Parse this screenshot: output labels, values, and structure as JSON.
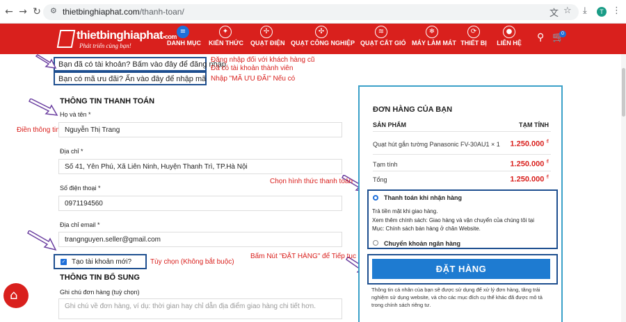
{
  "browser": {
    "url_domain": "thietbinghiaphat.com",
    "url_path": "/thanh-toan/",
    "avatar_letter": "T"
  },
  "site": {
    "logo_text": "thietbinghiaphat",
    "logo_suffix": "•com",
    "logo_slogan": "Phát triển cùng bạn!",
    "brand_color": "#d9201d",
    "menu": [
      {
        "label": "DANH MỤC",
        "icon": "menu-icon"
      },
      {
        "label": "KIẾN THỨC",
        "icon": "lightbulb-icon"
      },
      {
        "label": "QUẠT ĐIỆN",
        "icon": "fan-icon"
      },
      {
        "label": "QUẠT CÔNG NGHIỆP",
        "icon": "industrial-fan-icon"
      },
      {
        "label": "QUẠT CẮT GIÓ",
        "icon": "air-curtain-icon"
      },
      {
        "label": "MÁY LÀM MÁT",
        "icon": "cooler-icon"
      },
      {
        "label": "THIẾT BỊ",
        "icon": "device-icon"
      },
      {
        "label": "LIÊN HỆ",
        "icon": "location-icon"
      }
    ],
    "cart_count": "0"
  },
  "top": {
    "login_prompt": "Bạn đã có tài khoản? Bấm vào đây để đăng nhập",
    "login_note_1": "Đăng nhập đối với khách hàng cũ",
    "login_note_2": "Đã có tài khoản thành viên",
    "coupon_prompt": "Bạn có mã ưu đãi? Ấn vào đây để nhập mã",
    "coupon_note": "Nhập \"MÃ ƯU ĐÃI\" Nếu có"
  },
  "billing": {
    "title": "THÔNG TIN THANH TOÁN",
    "fill_note": "Điền thông tin",
    "name_label": "Họ và tên *",
    "name_value": "Nguyễn Thị Trang",
    "address_label": "Địa chỉ *",
    "address_value": "Số 41, Yên Phú, Xã Liên Ninh, Huyện Thanh Trì, TP.Hà Nội",
    "phone_label": "Số điện thoại *",
    "phone_value": "0971194560",
    "email_label": "Địa chỉ email *",
    "email_value": "trangnguyen.seller@gmail.com",
    "create_account_label": "Tạo tài khoản mới?",
    "create_account_note": "Tùy  chọn (Không bắt buộc)"
  },
  "extra": {
    "title": "THÔNG TIN BỔ SUNG",
    "notes_label": "Ghi chú đơn hàng (tuỳ chọn)",
    "notes_placeholder": "Ghi chú về đơn hàng, ví dụ: thời gian hay chỉ dẫn địa điểm giao hàng chi tiết hơn."
  },
  "order": {
    "title": "ĐƠN HÀNG CỦA BẠN",
    "col_product": "SẢN PHẨM",
    "col_subtotal": "TẠM TÍNH",
    "product_name": "Quạt hút gắn tường Panasonic FV-30AU1",
    "product_qty": "× 1",
    "product_price": "1.250.000",
    "subtotal_label": "Tạm tính",
    "subtotal_value": "1.250.000",
    "total_label": "Tổng",
    "total_value": "1.250.000",
    "currency": "₫",
    "payment_note": "Chọn hình thức thanh toán",
    "payment_cod": "Thanh toán khi nhận hàng",
    "payment_cod_desc_1": "Trả tiền mặt khi giao hàng.",
    "payment_cod_desc_2": "Xem thêm chính sách: Giao hàng và vận chuyển của chúng tôi tại",
    "payment_cod_desc_3": "Mục: Chính sách bán hàng ở chân Website.",
    "payment_bank": "Chuyển khoản ngân hàng",
    "button_note": "Bấm Nút \"ĐẶT HÀNG\" để Tiếp tục",
    "place_order": "ĐẶT HÀNG",
    "privacy_text": "Thông tin cá nhân của bạn sẽ được sử dụng để xử lý đơn hàng, tăng trải nghiệm sử dụng website, và cho các mục đích cụ thể khác đã được mô tả trong chính sách riêng tư."
  }
}
